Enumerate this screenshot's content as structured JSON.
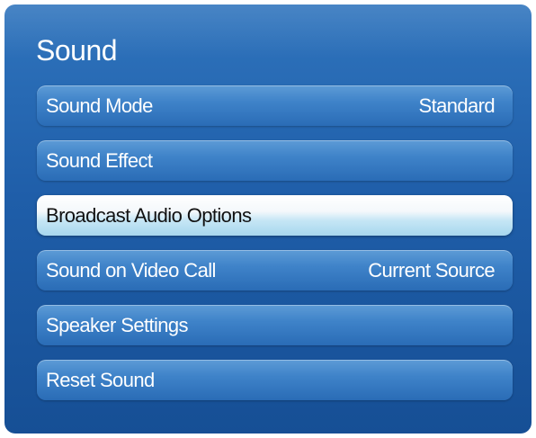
{
  "menu": {
    "title": "Sound",
    "items": [
      {
        "label": "Sound Mode",
        "value": "Standard"
      },
      {
        "label": "Sound Effect",
        "value": ""
      },
      {
        "label": "Broadcast Audio Options",
        "value": ""
      },
      {
        "label": "Sound on Video Call",
        "value": "Current Source"
      },
      {
        "label": "Speaker Settings",
        "value": ""
      },
      {
        "label": "Reset Sound",
        "value": ""
      }
    ],
    "selected_index": 2
  },
  "colors": {
    "panel_bg": "#1f5ea9",
    "item_bg": "#3f83c9",
    "selected_bg": "#c6e6f5",
    "text": "#ffffff",
    "selected_text": "#111111"
  }
}
